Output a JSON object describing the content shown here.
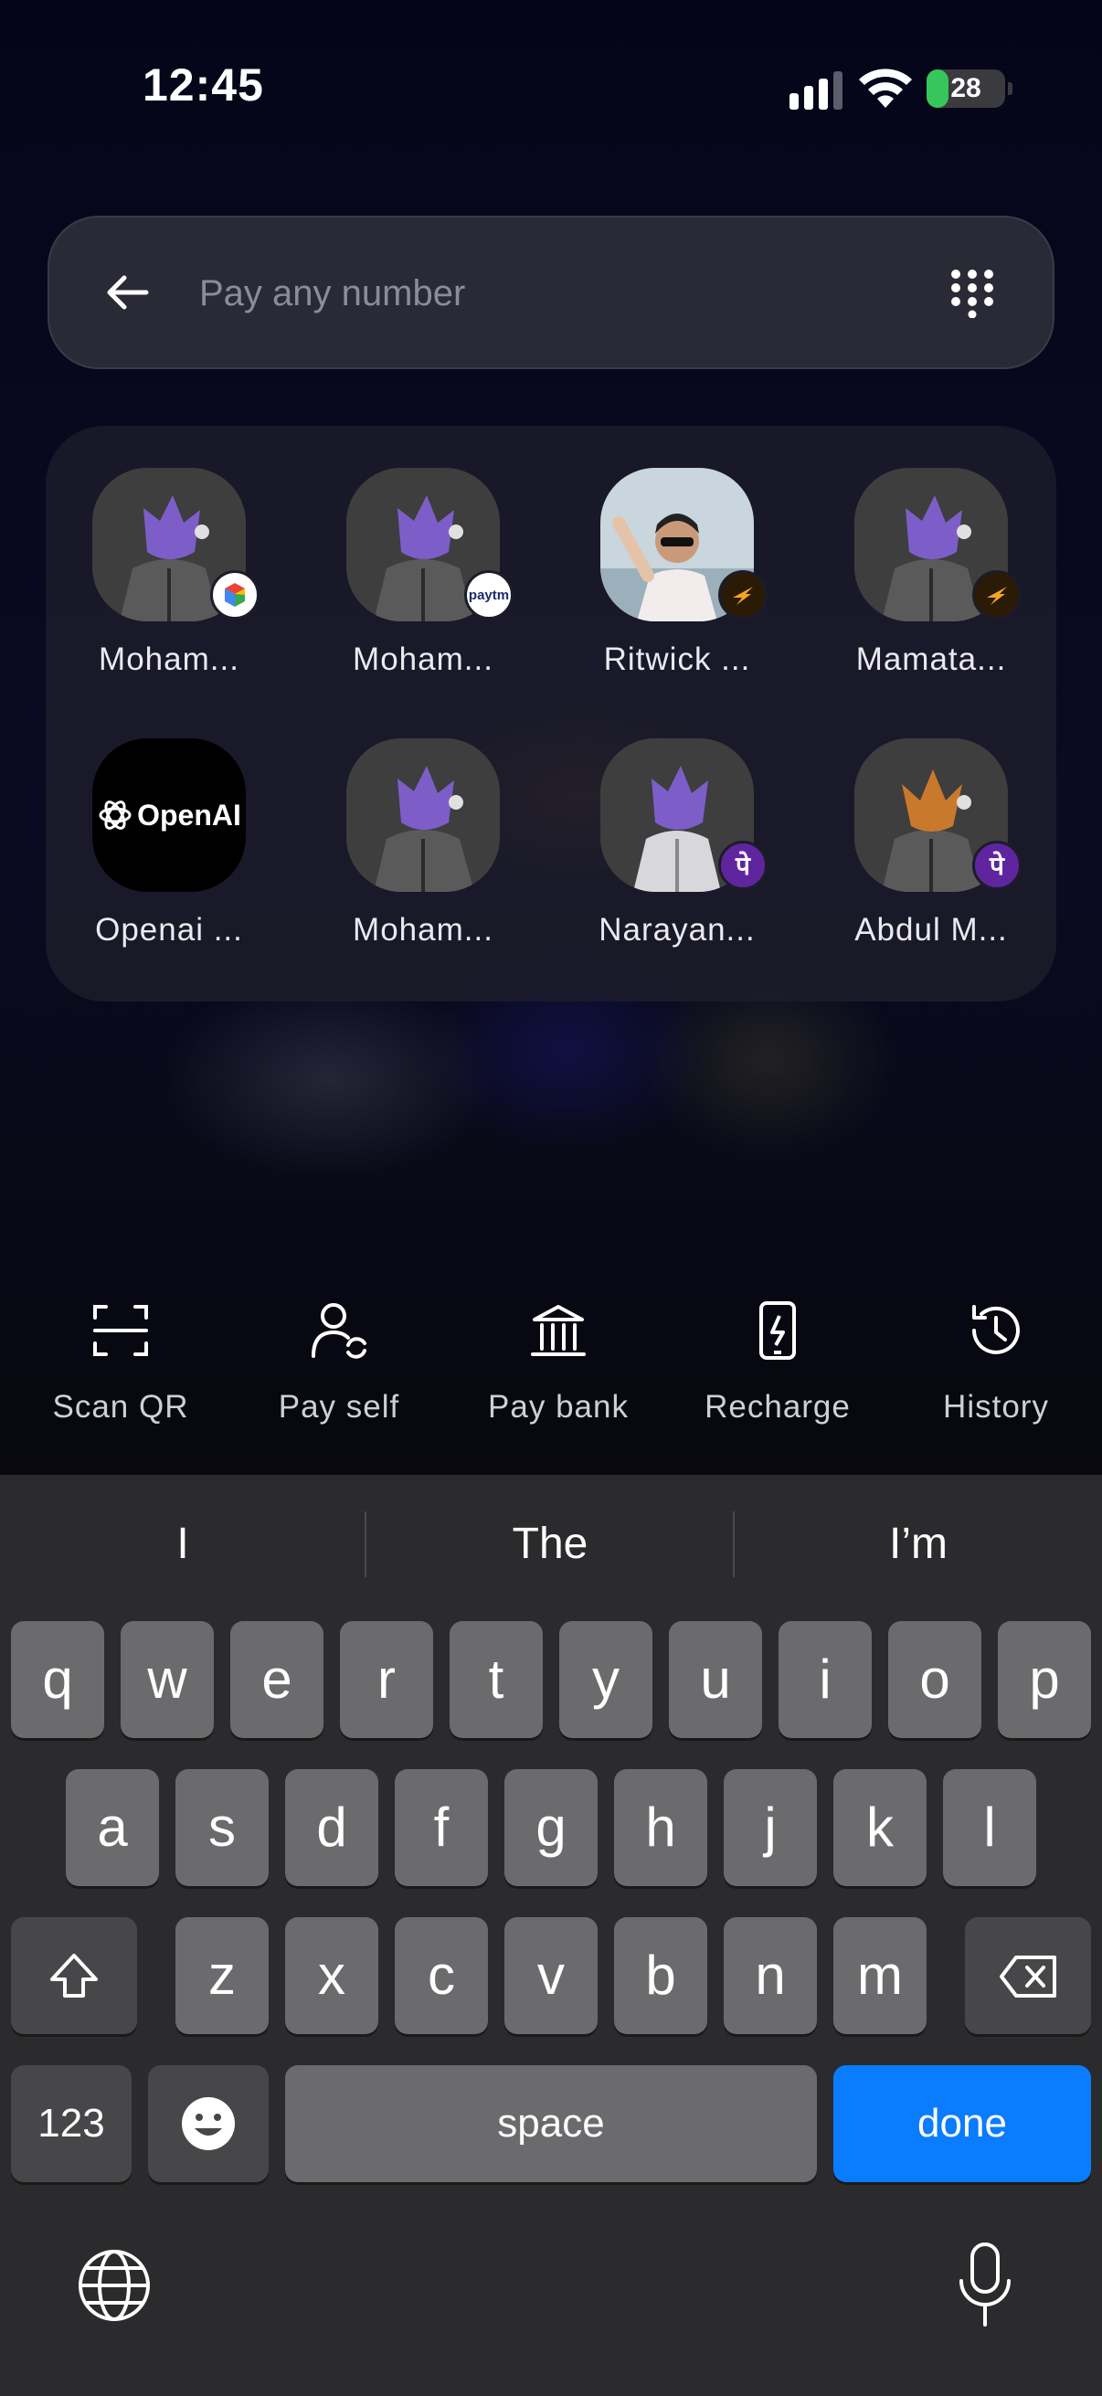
{
  "status": {
    "time": "12:45",
    "battery": "28",
    "battery_level": 0.28
  },
  "search": {
    "placeholder": "Pay any number"
  },
  "contacts": [
    {
      "name": "Moham...",
      "badge": "gpay"
    },
    {
      "name": "Moham...",
      "badge": "paytm",
      "badge_text": "paytm"
    },
    {
      "name": "Ritwick ...",
      "badge": "super"
    },
    {
      "name": "Mamata...",
      "badge": "super"
    },
    {
      "name": "Openai ...",
      "avatar_text": "OpenAI"
    },
    {
      "name": "Moham...",
      "badge": "none"
    },
    {
      "name": "Narayan...",
      "badge": "phonepe",
      "badge_text": "पे"
    },
    {
      "name": "Abdul M...",
      "badge": "phonepe",
      "badge_text": "पे"
    }
  ],
  "actions": [
    {
      "label": "Scan QR",
      "icon": "scan-qr-icon"
    },
    {
      "label": "Pay self",
      "icon": "pay-self-icon"
    },
    {
      "label": "Pay bank",
      "icon": "bank-icon"
    },
    {
      "label": "Recharge",
      "icon": "recharge-icon"
    },
    {
      "label": "History",
      "icon": "history-icon"
    }
  ],
  "keyboard": {
    "suggestions": [
      "I",
      "The",
      "I’m"
    ],
    "row1": [
      "q",
      "w",
      "e",
      "r",
      "t",
      "y",
      "u",
      "i",
      "o",
      "p"
    ],
    "row2": [
      "a",
      "s",
      "d",
      "f",
      "g",
      "h",
      "j",
      "k",
      "l"
    ],
    "row3": [
      "z",
      "x",
      "c",
      "v",
      "b",
      "n",
      "m"
    ],
    "numbers_label": "123",
    "space_label": "space",
    "done_label": "done",
    "done_color": "#0a7cff"
  }
}
